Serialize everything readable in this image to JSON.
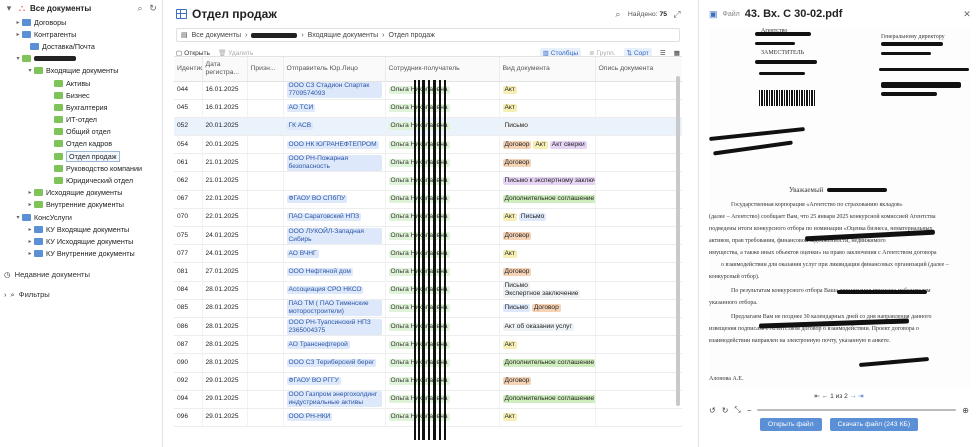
{
  "tree": {
    "root_label": "Все документы",
    "nodes": [
      {
        "label": "Договоры",
        "indent": 14,
        "arrow": "▸",
        "color": "blue"
      },
      {
        "label": "Контрагенты",
        "indent": 14,
        "arrow": "▸",
        "color": "blue"
      },
      {
        "label": "Доставка/Почта",
        "indent": 22,
        "arrow": "",
        "color": "blue"
      },
      {
        "label": "",
        "indent": 14,
        "arrow": "▾",
        "color": "green",
        "redacted": true
      },
      {
        "label": "Входящие документы",
        "indent": 26,
        "arrow": "▾",
        "color": "green"
      },
      {
        "label": "Активы",
        "indent": 46,
        "arrow": "",
        "color": "green"
      },
      {
        "label": "Бизнес",
        "indent": 46,
        "arrow": "",
        "color": "green"
      },
      {
        "label": "Бухгалтерия",
        "indent": 46,
        "arrow": "",
        "color": "green"
      },
      {
        "label": "ИТ-отдел",
        "indent": 46,
        "arrow": "",
        "color": "green"
      },
      {
        "label": "Общий отдел",
        "indent": 46,
        "arrow": "",
        "color": "green"
      },
      {
        "label": "Отдел кадров",
        "indent": 46,
        "arrow": "",
        "color": "green"
      },
      {
        "label": "Отдел продаж",
        "indent": 46,
        "arrow": "",
        "color": "green",
        "selected": true
      },
      {
        "label": "Руководство компании",
        "indent": 46,
        "arrow": "",
        "color": "green"
      },
      {
        "label": "Юридический отдел",
        "indent": 46,
        "arrow": "",
        "color": "green"
      },
      {
        "label": "Исходящие документы",
        "indent": 26,
        "arrow": "▸",
        "color": "green"
      },
      {
        "label": "Внутренние документы",
        "indent": 26,
        "arrow": "▸",
        "color": "green"
      },
      {
        "label": "КонсУслуги",
        "indent": 14,
        "arrow": "▾",
        "color": "blue"
      },
      {
        "label": "КУ Входящие документы",
        "indent": 26,
        "arrow": "▸",
        "color": "blue"
      },
      {
        "label": "КУ Исходящие документы",
        "indent": 26,
        "arrow": "▸",
        "color": "blue"
      },
      {
        "label": "КУ Внутренние документы",
        "indent": 26,
        "arrow": "▸",
        "color": "blue"
      }
    ],
    "recent_label": "Недавние документы",
    "filters_label": "Фильтры"
  },
  "main": {
    "title": "Отдел продаж",
    "found_label": "Найдено:",
    "found_count": "75",
    "breadcrumb": [
      "Все документы",
      "Входящие документы",
      "Отдел продаж"
    ],
    "toolbar": {
      "open": "Открыть",
      "delete": "Удалить",
      "columns": "Столбцы",
      "group": "Групп.",
      "sort": "Сорт"
    },
    "columns": [
      "Идентифик...",
      "Дата регистра...",
      "Призн...",
      "Отправитель Юр.Лицо",
      "Сотрудник-получатель",
      "Вид документа",
      "Опись документа"
    ],
    "rows": [
      {
        "id": "044",
        "date": "16.01.2025",
        "sender": "ООО СЗ Стадион Спартак 7709574093",
        "employee": "Ольга Николаевна",
        "tags": [
          {
            "t": "Акт",
            "c": "y"
          }
        ]
      },
      {
        "id": "045",
        "date": "16.01.2025",
        "sender": "АО ТСИ",
        "employee": "Ольга Николаевна",
        "tags": [
          {
            "t": "Акт",
            "c": "y"
          }
        ]
      },
      {
        "id": "052",
        "date": "20.01.2025",
        "sender": "ГК АСВ",
        "employee": "Ольга Николаевна",
        "tags": [
          {
            "t": "Письмо",
            "c": "w"
          }
        ],
        "highlight": true
      },
      {
        "id": "054",
        "date": "20.01.2025",
        "sender": "ООО НК ЮГРАНЕФТЕПРОМ",
        "employee": "Ольга Николаевна",
        "tags": [
          {
            "t": "Договор",
            "c": "o"
          },
          {
            "t": "Акт",
            "c": "y"
          },
          {
            "t": "Акт сверки",
            "c": "p"
          }
        ]
      },
      {
        "id": "061",
        "date": "21.01.2025",
        "sender": "ООО РН-Пожарная безопасность",
        "employee": "Ольга Николаевна",
        "tags": [
          {
            "t": "Договор",
            "c": "o"
          }
        ]
      },
      {
        "id": "062",
        "date": "21.01.2025",
        "sender": "",
        "employee": "Ольга Николаевна",
        "tags": [
          {
            "t": "Письмо к экспертному заключению",
            "c": "p"
          }
        ]
      },
      {
        "id": "067",
        "date": "22.01.2025",
        "sender": "ФГАОУ ВО СПбПУ",
        "employee": "Ольга Николаевна",
        "tags": [
          {
            "t": "Дополнительное соглашение",
            "c": "g"
          }
        ]
      },
      {
        "id": "070",
        "date": "22.01.2025",
        "sender": "ПАО Саратовский НПЗ",
        "employee": "Ольга Николаевна",
        "tags": [
          {
            "t": "Акт",
            "c": "y"
          },
          {
            "t": "Письмо",
            "c": "b"
          }
        ]
      },
      {
        "id": "075",
        "date": "24.01.2025",
        "sender": "ООО ЛУКОЙЛ-Западная Сибирь",
        "employee": "Ольга Николаевна",
        "tags": [
          {
            "t": "Договор",
            "c": "o"
          }
        ]
      },
      {
        "id": "077",
        "date": "24.01.2025",
        "sender": "АО ВЧНГ",
        "employee": "Ольга Николаевна",
        "tags": [
          {
            "t": "Акт",
            "c": "y"
          }
        ]
      },
      {
        "id": "081",
        "date": "27.01.2025",
        "sender": "ООО Нефтяной дом",
        "employee": "Ольга Николаевна",
        "tags": [
          {
            "t": "Договор",
            "c": "o"
          }
        ]
      },
      {
        "id": "084",
        "date": "28.01.2025",
        "sender": "Ассоциация СРО НКСО",
        "employee": "Ольга Николаевна",
        "tags": [
          {
            "t": "Письмо",
            "c": "w"
          },
          {
            "t": "Экспертное заключение",
            "c": "w"
          }
        ]
      },
      {
        "id": "085",
        "date": "28.01.2025",
        "sender": "ПАО ТМ ( ПАО Тименские моторостроители)",
        "employee": "Ольга Николаевна",
        "tags": [
          {
            "t": "Письмо",
            "c": "b"
          },
          {
            "t": "Договор",
            "c": "o"
          }
        ]
      },
      {
        "id": "086",
        "date": "28.01.2025",
        "sender": "ООО РН-Туапсинский НПЗ 2365004375",
        "employee": "Ольга Николаевна",
        "tags": [
          {
            "t": "Акт об оказании услуг",
            "c": "w"
          }
        ]
      },
      {
        "id": "087",
        "date": "28.01.2025",
        "sender": "АО Транснефтерой",
        "employee": "Ольга Николаевна",
        "tags": [
          {
            "t": "Акт",
            "c": "y"
          }
        ]
      },
      {
        "id": "090",
        "date": "28.01.2025",
        "sender": "ООО СЗ Териберский берег",
        "employee": "Ольга Николаевна",
        "tags": [
          {
            "t": "Дополнительное соглашение",
            "c": "g"
          }
        ]
      },
      {
        "id": "092",
        "date": "29.01.2025",
        "sender": "ФГАОУ ВО РГГУ",
        "employee": "Ольга Николаевна",
        "tags": [
          {
            "t": "Договор",
            "c": "o"
          }
        ]
      },
      {
        "id": "094",
        "date": "29.01.2025",
        "sender": "ООО Газпром энергохолдинг индустриальные активы",
        "employee": "Ольга Николаевна",
        "tags": [
          {
            "t": "Дополнительное соглашение",
            "c": "g"
          }
        ]
      },
      {
        "id": "096",
        "date": "29.01.2025",
        "sender": "ООО РН-НКИ",
        "employee": "Ольга Николаевна",
        "tags": [
          {
            "t": "Акт",
            "c": "y"
          }
        ]
      }
    ]
  },
  "viewer": {
    "file_label": "Файл",
    "file_name": "43. Вх. С 30-02.pdf",
    "page_text": {
      "agency": "Агентство",
      "deputy": "ЗАМЕСТИТЕЛЬ",
      "gen_director": "Генеральному директору",
      "dear": "Уважаемый",
      "para1": "Государственная корпорация «Агентство по страхованию вкладов»",
      "para2": "(далее – Агентство) сообщает Вам, что 25 января 2025 конкурсной комиссией Агентства",
      "para3": "подведены итоги конкурсного отбора по номинации «Оценка бизнеса, нематериальных",
      "para4": "активов, прав требования, финансовой задолженности, недвижимого",
      "para5": "имущества, а также иных объектов оценки» на право заключения с Агентством договора",
      "para6": "о взаимодействии для оказания услуг при ликвидации финансовых организаций (далее –",
      "para7": "конкурсный отбор).",
      "para8": "По результатам конкурсного отбора Ваша организация признана победителем",
      "para9": "указанного отбора.",
      "para10": "Предлагаем Вам не позднее 30 календарных дней со дня направления данного",
      "para11": "извещения подписать с Агентством договор о взаимодействии. Проект договора о",
      "para12": "взаимодействии направлен на электронную почту, указанную в анкете.",
      "signer": "Алонова А.Е."
    },
    "pager": "1 из 2",
    "open_button": "Открыть файл",
    "download_button": "Скачать файл (243 КБ)"
  }
}
